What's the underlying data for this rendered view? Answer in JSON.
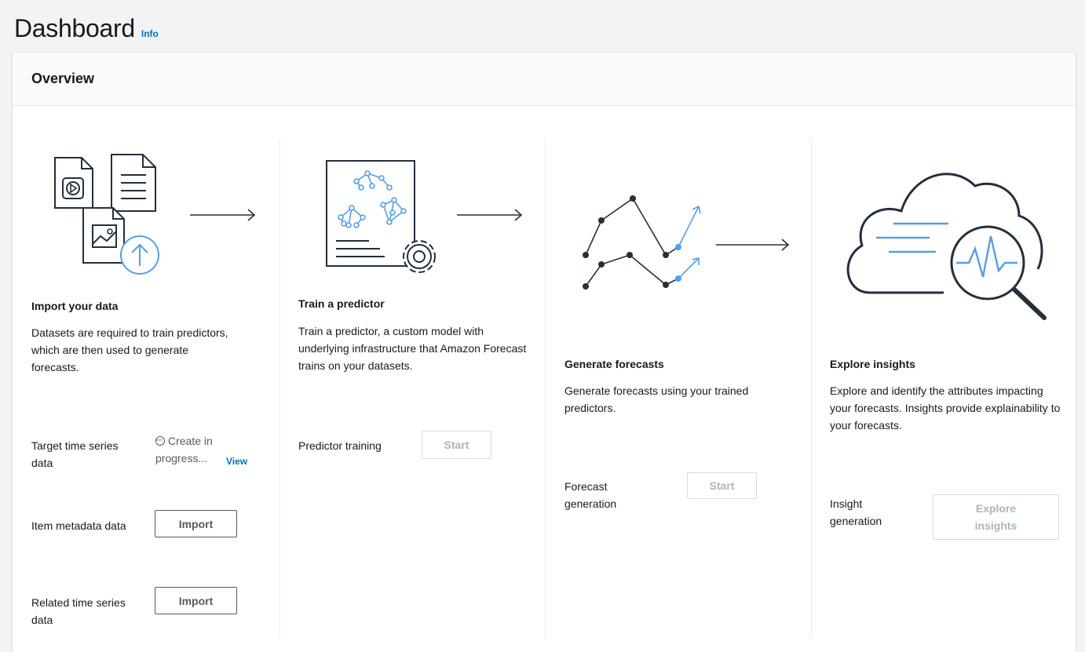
{
  "page": {
    "title": "Dashboard",
    "info_link": "Info"
  },
  "overview": {
    "title": "Overview"
  },
  "import_step": {
    "heading": "Import your data",
    "description": "Datasets are required to train predictors, which are then used to generate forecasts.",
    "rows": [
      {
        "label": "Target time series data",
        "status": "Create in progress...",
        "status_icon": "ellipsis-circle-icon",
        "link": "View"
      },
      {
        "label": "Item metadata data",
        "button": "Import"
      },
      {
        "label": "Related time series data",
        "button": "Import"
      }
    ]
  },
  "train_step": {
    "heading": "Train a predictor",
    "description": "Train a predictor, a custom model with underlying infrastructure that Amazon Forecast trains on your datasets.",
    "row_label": "Predictor training",
    "button": "Start"
  },
  "forecast_step": {
    "heading": "Generate forecasts",
    "description": "Generate forecasts using your trained predictors.",
    "row_label": "Forecast generation",
    "button": "Start"
  },
  "insights_step": {
    "heading": "Explore insights",
    "description": "Explore and identify the attributes impacting your forecasts. Insights provide explainability to your forecasts.",
    "row_label": "Insight generation",
    "button": "Explore insights"
  },
  "colors": {
    "accent": "#539fe5",
    "link": "#0073bb",
    "ink": "#232f3e",
    "disabled": "#aab7b8"
  }
}
